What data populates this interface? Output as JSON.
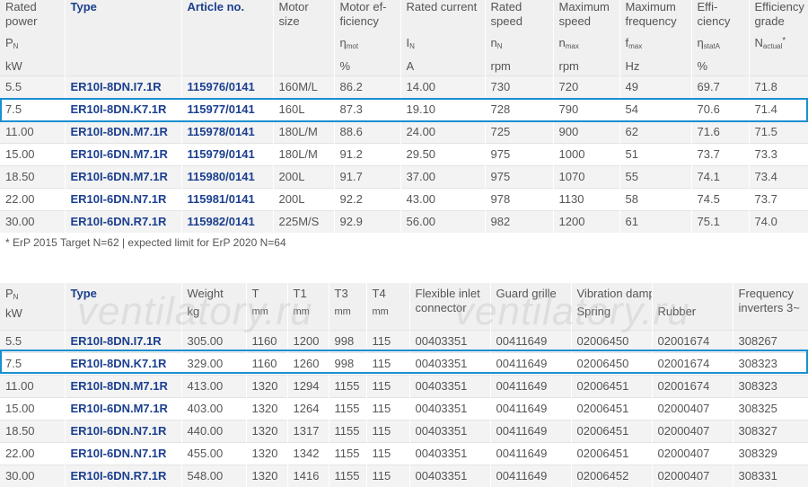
{
  "table1": {
    "headers": {
      "rated_power": [
        "Rated",
        "power"
      ],
      "rated_power_sym": "P",
      "rated_power_sub": "N",
      "rated_power_unit": "kW",
      "type": "Type",
      "article": "Article no.",
      "motor_size": [
        "Motor",
        "size"
      ],
      "motor_eff": [
        "Motor ef-",
        "ficiency"
      ],
      "motor_eff_sym": "η",
      "motor_eff_sub": "mot",
      "motor_eff_unit": "%",
      "rated_current": "Rated current",
      "rated_current_sym": "I",
      "rated_current_sub": "N",
      "rated_current_unit": "A",
      "rated_speed": [
        "Rated",
        "speed"
      ],
      "rated_speed_sym": "n",
      "rated_speed_sub": "N",
      "rated_speed_unit": "rpm",
      "max_speed": [
        "Maximum",
        "speed"
      ],
      "max_speed_sym": "n",
      "max_speed_sub": "max",
      "max_speed_unit": "rpm",
      "max_freq": [
        "Maximum",
        "frequency"
      ],
      "max_freq_sym": "f",
      "max_freq_sub": "max",
      "max_freq_unit": "Hz",
      "efficiency": [
        "Effi-",
        "ciency"
      ],
      "efficiency_sym": "η",
      "efficiency_sub": "statA",
      "efficiency_unit": "%",
      "eff_grade": [
        "Efficiency",
        "grade"
      ],
      "eff_grade_sym": "N",
      "eff_grade_sub": "actual",
      "eff_grade_sup": "*"
    },
    "rows": [
      [
        "5.5",
        "ER10I-8DN.I7.1R",
        "115976/0141",
        "160M/L",
        "86.2",
        "14.00",
        "730",
        "720",
        "49",
        "69.7",
        "71.8"
      ],
      [
        "7.5",
        "ER10I-8DN.K7.1R",
        "115977/0141",
        "160L",
        "87.3",
        "19.10",
        "728",
        "790",
        "54",
        "70.6",
        "71.4"
      ],
      [
        "11.00",
        "ER10I-8DN.M7.1R",
        "115978/0141",
        "180L/M",
        "88.6",
        "24.00",
        "725",
        "900",
        "62",
        "71.6",
        "71.5"
      ],
      [
        "15.00",
        "ER10I-6DN.M7.1R",
        "115979/0141",
        "180L/M",
        "91.2",
        "29.50",
        "975",
        "1000",
        "51",
        "73.7",
        "73.3"
      ],
      [
        "18.50",
        "ER10I-6DN.M7.1R",
        "115980/0141",
        "200L",
        "91.7",
        "37.00",
        "975",
        "1070",
        "55",
        "74.1",
        "73.4"
      ],
      [
        "22.00",
        "ER10I-6DN.N7.1R",
        "115981/0141",
        "200L",
        "92.2",
        "43.00",
        "978",
        "1130",
        "58",
        "74.5",
        "73.7"
      ],
      [
        "30.00",
        "ER10I-6DN.R7.1R",
        "115982/0141",
        "225M/S",
        "92.9",
        "56.00",
        "982",
        "1200",
        "61",
        "75.1",
        "74.0"
      ]
    ],
    "footnote": "* ErP 2015 Target N=62 | expected limit for ErP 2020 N=64"
  },
  "table2": {
    "headers": {
      "pn_sym": "P",
      "pn_sub": "N",
      "pn_unit": "kW",
      "type": "Type",
      "weight": "Weight",
      "weight_unit": "kg",
      "t": "T",
      "t_unit": "mm",
      "t1": "T1",
      "t1_unit": "mm",
      "t3": "T3",
      "t3_unit": "mm",
      "t4": "T4",
      "t4_unit": "mm",
      "flex": [
        "Flexible inlet",
        "connector"
      ],
      "guard": "Guard grille",
      "vib": "Vibration damper",
      "vib_spring": "Spring",
      "vib_rubber": "Rubber",
      "freq": [
        "Frequency",
        "inverters 3~"
      ]
    },
    "rows": [
      [
        "5.5",
        "ER10I-8DN.I7.1R",
        "305.00",
        "1160",
        "1200",
        "998",
        "115",
        "00403351",
        "00411649",
        "02006450",
        "02001674",
        "308267"
      ],
      [
        "7.5",
        "ER10I-8DN.K7.1R",
        "329.00",
        "1160",
        "1260",
        "998",
        "115",
        "00403351",
        "00411649",
        "02006450",
        "02001674",
        "308323"
      ],
      [
        "11.00",
        "ER10I-8DN.M7.1R",
        "413.00",
        "1320",
        "1294",
        "1155",
        "115",
        "00403351",
        "00411649",
        "02006451",
        "02001674",
        "308323"
      ],
      [
        "15.00",
        "ER10I-6DN.M7.1R",
        "403.00",
        "1320",
        "1264",
        "1155",
        "115",
        "00403351",
        "00411649",
        "02006451",
        "02000407",
        "308325"
      ],
      [
        "18.50",
        "ER10I-6DN.N7.1R",
        "440.00",
        "1320",
        "1317",
        "1155",
        "115",
        "00403351",
        "00411649",
        "02006451",
        "02000407",
        "308327"
      ],
      [
        "22.00",
        "ER10I-6DN.N7.1R",
        "455.00",
        "1320",
        "1342",
        "1155",
        "115",
        "00403351",
        "00411649",
        "02006451",
        "02000407",
        "308329"
      ],
      [
        "30.00",
        "ER10I-6DN.R7.1R",
        "548.00",
        "1320",
        "1416",
        "1155",
        "115",
        "00403351",
        "00411649",
        "02006452",
        "02000407",
        "308331"
      ]
    ]
  },
  "watermark": "ventilatory.ru",
  "highlight_color": "#1a8fd0",
  "link_color": "#1b3f8f"
}
